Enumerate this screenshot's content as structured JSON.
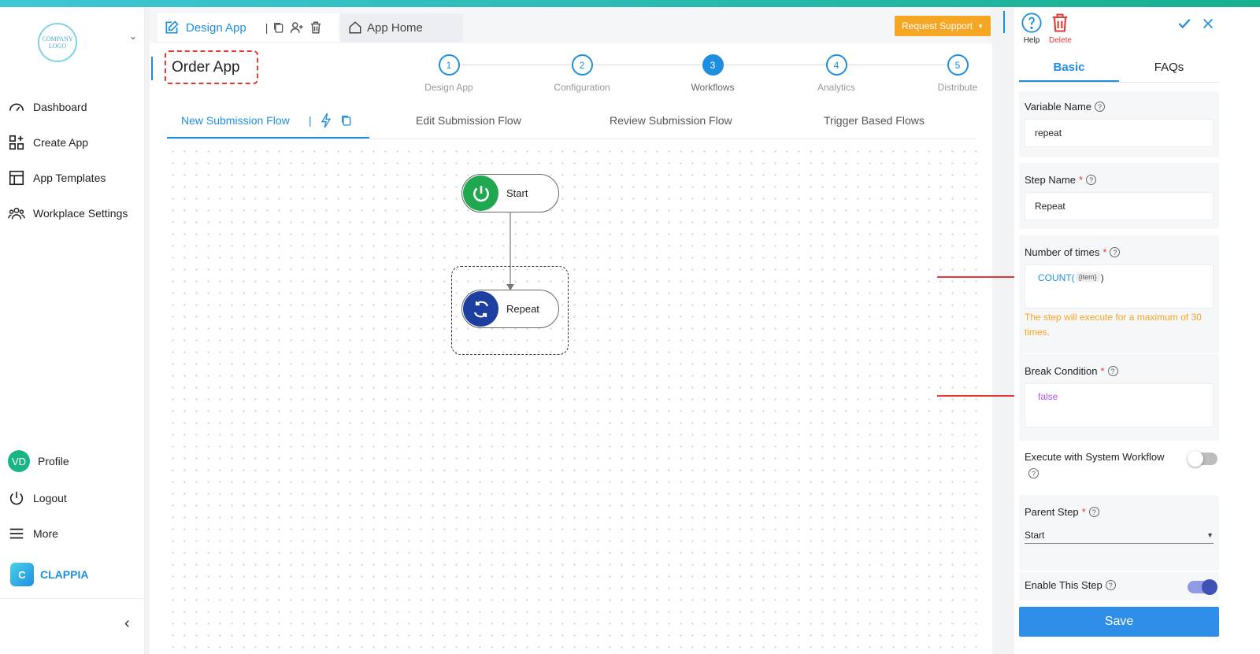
{
  "sidebar": {
    "logo_text": "COMPANY LOGO",
    "items": [
      {
        "label": "Dashboard",
        "icon": "dashboard-icon"
      },
      {
        "label": "Create App",
        "icon": "create-app-icon"
      },
      {
        "label": "App Templates",
        "icon": "templates-icon"
      },
      {
        "label": "Workplace Settings",
        "icon": "people-icon"
      }
    ],
    "profile": {
      "initials": "VD",
      "label": "Profile"
    },
    "logout_label": "Logout",
    "more_label": "More",
    "brand": {
      "letter": "C",
      "label": "CLAPPIA"
    }
  },
  "header": {
    "design_tab": "Design App",
    "home_tab": "App Home",
    "request_support": "Request Support",
    "app_name": "Order App"
  },
  "stepper": [
    {
      "num": "1",
      "label": "Design App"
    },
    {
      "num": "2",
      "label": "Configuration"
    },
    {
      "num": "3",
      "label": "Workflows"
    },
    {
      "num": "4",
      "label": "Analytics"
    },
    {
      "num": "5",
      "label": "Distribute"
    }
  ],
  "flow_tabs": [
    "New Submission Flow",
    "Edit Submission Flow",
    "Review Submission Flow",
    "Trigger Based Flows"
  ],
  "nodes": {
    "start": "Start",
    "repeat": "Repeat"
  },
  "panel": {
    "help": "Help",
    "delete": "Delete",
    "tabs": [
      "Basic",
      "FAQs"
    ],
    "variable_name": {
      "label": "Variable Name",
      "value": "repeat"
    },
    "step_name": {
      "label": "Step Name",
      "value": "Repeat"
    },
    "number_of_times": {
      "label": "Number of times",
      "func": "COUNT(",
      "chip": "{item}",
      "close": ")",
      "hint": "The step will execute for a maximum of 30 times."
    },
    "break_condition": {
      "label": "Break Condition",
      "value": "false"
    },
    "system_workflow": {
      "label": "Execute with System Workflow",
      "enabled": false
    },
    "parent_step": {
      "label": "Parent Step",
      "value": "Start"
    },
    "enable_step": {
      "label": "Enable This Step",
      "enabled": true
    },
    "save": "Save"
  },
  "colors": {
    "primary": "#1e8fe0",
    "accent": "#f5a623",
    "start_node": "#1fa84f",
    "repeat_node": "#1d3fa0",
    "annotation": "#e53935"
  }
}
